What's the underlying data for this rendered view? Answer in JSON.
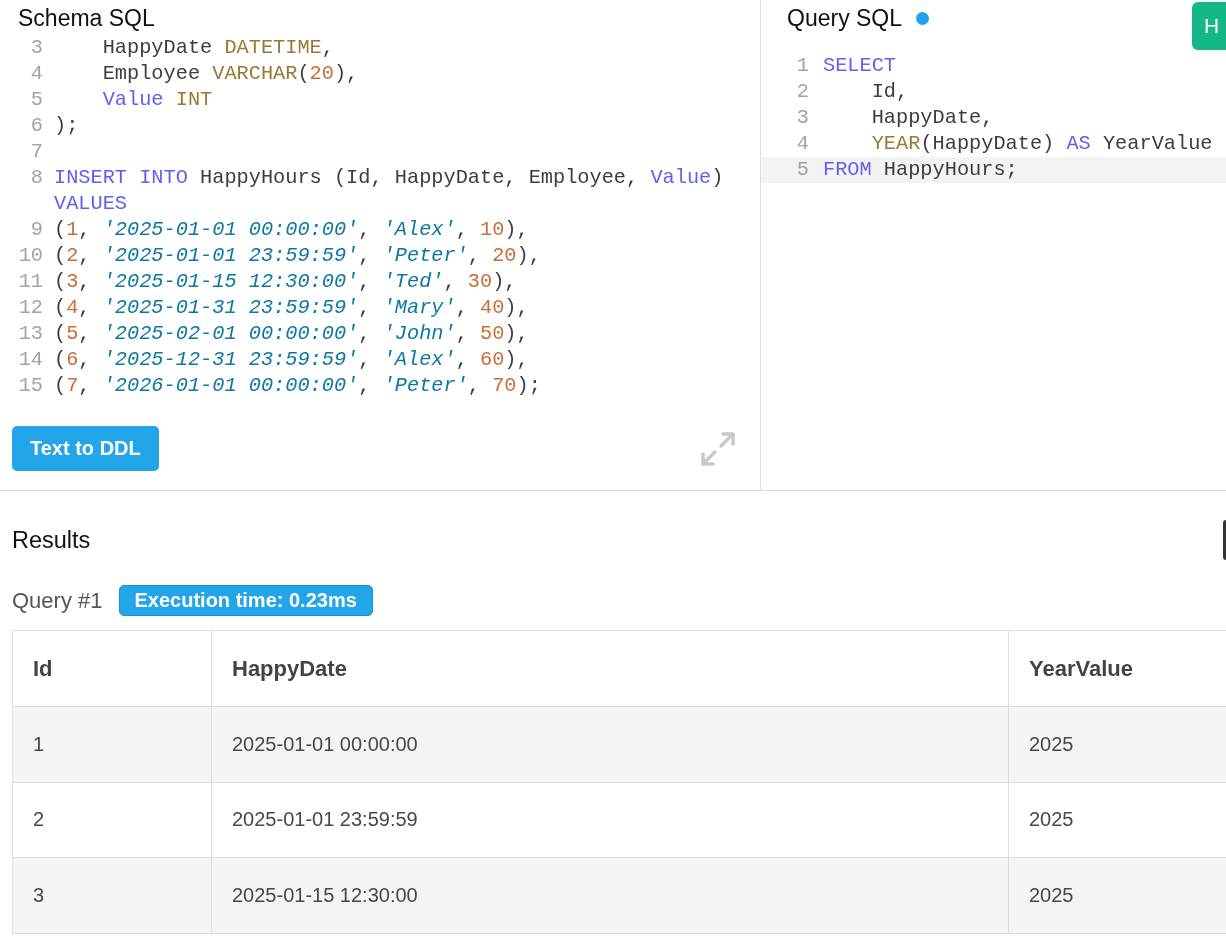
{
  "schema": {
    "title": "Schema SQL",
    "lines": [
      {
        "number": "3",
        "tokens": [
          {
            "text": "    HappyDate ",
            "kind": "plain"
          },
          {
            "text": "DATETIME",
            "kind": "type"
          },
          {
            "text": ",",
            "kind": "plain"
          }
        ]
      },
      {
        "number": "4",
        "tokens": [
          {
            "text": "    Employee ",
            "kind": "plain"
          },
          {
            "text": "VARCHAR",
            "kind": "type"
          },
          {
            "text": "(",
            "kind": "plain"
          },
          {
            "text": "20",
            "kind": "number"
          },
          {
            "text": "),",
            "kind": "plain"
          }
        ]
      },
      {
        "number": "5",
        "tokens": [
          {
            "text": "    Value",
            "kind": "keyword"
          },
          {
            "text": " INT",
            "kind": "type"
          }
        ]
      },
      {
        "number": "6",
        "tokens": [
          {
            "text": ");",
            "kind": "plain"
          }
        ]
      },
      {
        "number": "7"
      },
      {
        "number": "8",
        "tokens": [
          {
            "text": "INSERT INTO",
            "kind": "keyword"
          },
          {
            "text": " HappyHours (Id, HappyDate, Employee, ",
            "kind": "plain"
          },
          {
            "text": "Value",
            "kind": "keyword"
          },
          {
            "text": ") ",
            "kind": "plain"
          },
          {
            "text": "VALUES",
            "kind": "keyword"
          }
        ]
      },
      {
        "number": "9",
        "tokens": [
          {
            "text": "(",
            "kind": "plain"
          },
          {
            "text": "1",
            "kind": "number"
          },
          {
            "text": ", ",
            "kind": "plain"
          },
          {
            "text": "'2025-01-01 00:00:00'",
            "kind": "string"
          },
          {
            "text": ", ",
            "kind": "plain"
          },
          {
            "text": "'Alex'",
            "kind": "string"
          },
          {
            "text": ", ",
            "kind": "plain"
          },
          {
            "text": "10",
            "kind": "number"
          },
          {
            "text": "),",
            "kind": "plain"
          }
        ]
      },
      {
        "number": "10",
        "tokens": [
          {
            "text": "(",
            "kind": "plain"
          },
          {
            "text": "2",
            "kind": "number"
          },
          {
            "text": ", ",
            "kind": "plain"
          },
          {
            "text": "'2025-01-01 23:59:59'",
            "kind": "string"
          },
          {
            "text": ", ",
            "kind": "plain"
          },
          {
            "text": "'Peter'",
            "kind": "string"
          },
          {
            "text": ", ",
            "kind": "plain"
          },
          {
            "text": "20",
            "kind": "number"
          },
          {
            "text": "),",
            "kind": "plain"
          }
        ]
      },
      {
        "number": "11",
        "tokens": [
          {
            "text": "(",
            "kind": "plain"
          },
          {
            "text": "3",
            "kind": "number"
          },
          {
            "text": ", ",
            "kind": "plain"
          },
          {
            "text": "'2025-01-15 12:30:00'",
            "kind": "string"
          },
          {
            "text": ", ",
            "kind": "plain"
          },
          {
            "text": "'Ted'",
            "kind": "string"
          },
          {
            "text": ", ",
            "kind": "plain"
          },
          {
            "text": "30",
            "kind": "number"
          },
          {
            "text": "),",
            "kind": "plain"
          }
        ]
      },
      {
        "number": "12",
        "tokens": [
          {
            "text": "(",
            "kind": "plain"
          },
          {
            "text": "4",
            "kind": "number"
          },
          {
            "text": ", ",
            "kind": "plain"
          },
          {
            "text": "'2025-01-31 23:59:59'",
            "kind": "string"
          },
          {
            "text": ", ",
            "kind": "plain"
          },
          {
            "text": "'Mary'",
            "kind": "string"
          },
          {
            "text": ", ",
            "kind": "plain"
          },
          {
            "text": "40",
            "kind": "number"
          },
          {
            "text": "),",
            "kind": "plain"
          }
        ]
      },
      {
        "number": "13",
        "tokens": [
          {
            "text": "(",
            "kind": "plain"
          },
          {
            "text": "5",
            "kind": "number"
          },
          {
            "text": ", ",
            "kind": "plain"
          },
          {
            "text": "'2025-02-01 00:00:00'",
            "kind": "string"
          },
          {
            "text": ", ",
            "kind": "plain"
          },
          {
            "text": "'John'",
            "kind": "string"
          },
          {
            "text": ", ",
            "kind": "plain"
          },
          {
            "text": "50",
            "kind": "number"
          },
          {
            "text": "),",
            "kind": "plain"
          }
        ]
      },
      {
        "number": "14",
        "tokens": [
          {
            "text": "(",
            "kind": "plain"
          },
          {
            "text": "6",
            "kind": "number"
          },
          {
            "text": ", ",
            "kind": "plain"
          },
          {
            "text": "'2025-12-31 23:59:59'",
            "kind": "string"
          },
          {
            "text": ", ",
            "kind": "plain"
          },
          {
            "text": "'Alex'",
            "kind": "string"
          },
          {
            "text": ", ",
            "kind": "plain"
          },
          {
            "text": "60",
            "kind": "number"
          },
          {
            "text": "),",
            "kind": "plain"
          }
        ]
      },
      {
        "number": "15",
        "tokens": [
          {
            "text": "(",
            "kind": "plain"
          },
          {
            "text": "7",
            "kind": "number"
          },
          {
            "text": ", ",
            "kind": "plain"
          },
          {
            "text": "'2026-01-01 00:00:00'",
            "kind": "string"
          },
          {
            "text": ", ",
            "kind": "plain"
          },
          {
            "text": "'Peter'",
            "kind": "string"
          },
          {
            "text": ", ",
            "kind": "plain"
          },
          {
            "text": "70",
            "kind": "number"
          },
          {
            "text": ");",
            "kind": "plain"
          }
        ]
      }
    ],
    "button": "Text to DDL"
  },
  "query": {
    "title": "Query SQL",
    "indicator_dot": true,
    "button": "H",
    "lines": [
      {
        "number": "1",
        "active": false,
        "tokens": [
          {
            "text": "SELECT",
            "kind": "keyword"
          }
        ]
      },
      {
        "number": "2",
        "active": false,
        "tokens": [
          {
            "text": "    Id,",
            "kind": "plain"
          }
        ]
      },
      {
        "number": "3",
        "active": false,
        "tokens": [
          {
            "text": "    HappyDate,",
            "kind": "plain"
          }
        ]
      },
      {
        "number": "4",
        "active": false,
        "tokens": [
          {
            "text": "    YEAR",
            "kind": "type"
          },
          {
            "text": "(HappyDate) ",
            "kind": "plain"
          },
          {
            "text": "AS",
            "kind": "keyword"
          },
          {
            "text": " YearValue",
            "kind": "plain"
          }
        ]
      },
      {
        "number": "5",
        "active": true,
        "tokens": [
          {
            "text": "FROM",
            "kind": "keyword"
          },
          {
            "text": " HappyHours;",
            "kind": "plain"
          }
        ]
      }
    ]
  },
  "results": {
    "title": "Results",
    "query_label": "Query #1",
    "execution_time": "Execution time: 0.23ms",
    "table": {
      "columns": [
        "Id",
        "HappyDate",
        "YearValue"
      ],
      "rows": [
        [
          "1",
          "2025-01-01 00:00:00",
          "2025"
        ],
        [
          "2",
          "2025-01-01 23:59:59",
          "2025"
        ],
        [
          "3",
          "2025-01-15 12:30:00",
          "2025"
        ]
      ]
    }
  }
}
